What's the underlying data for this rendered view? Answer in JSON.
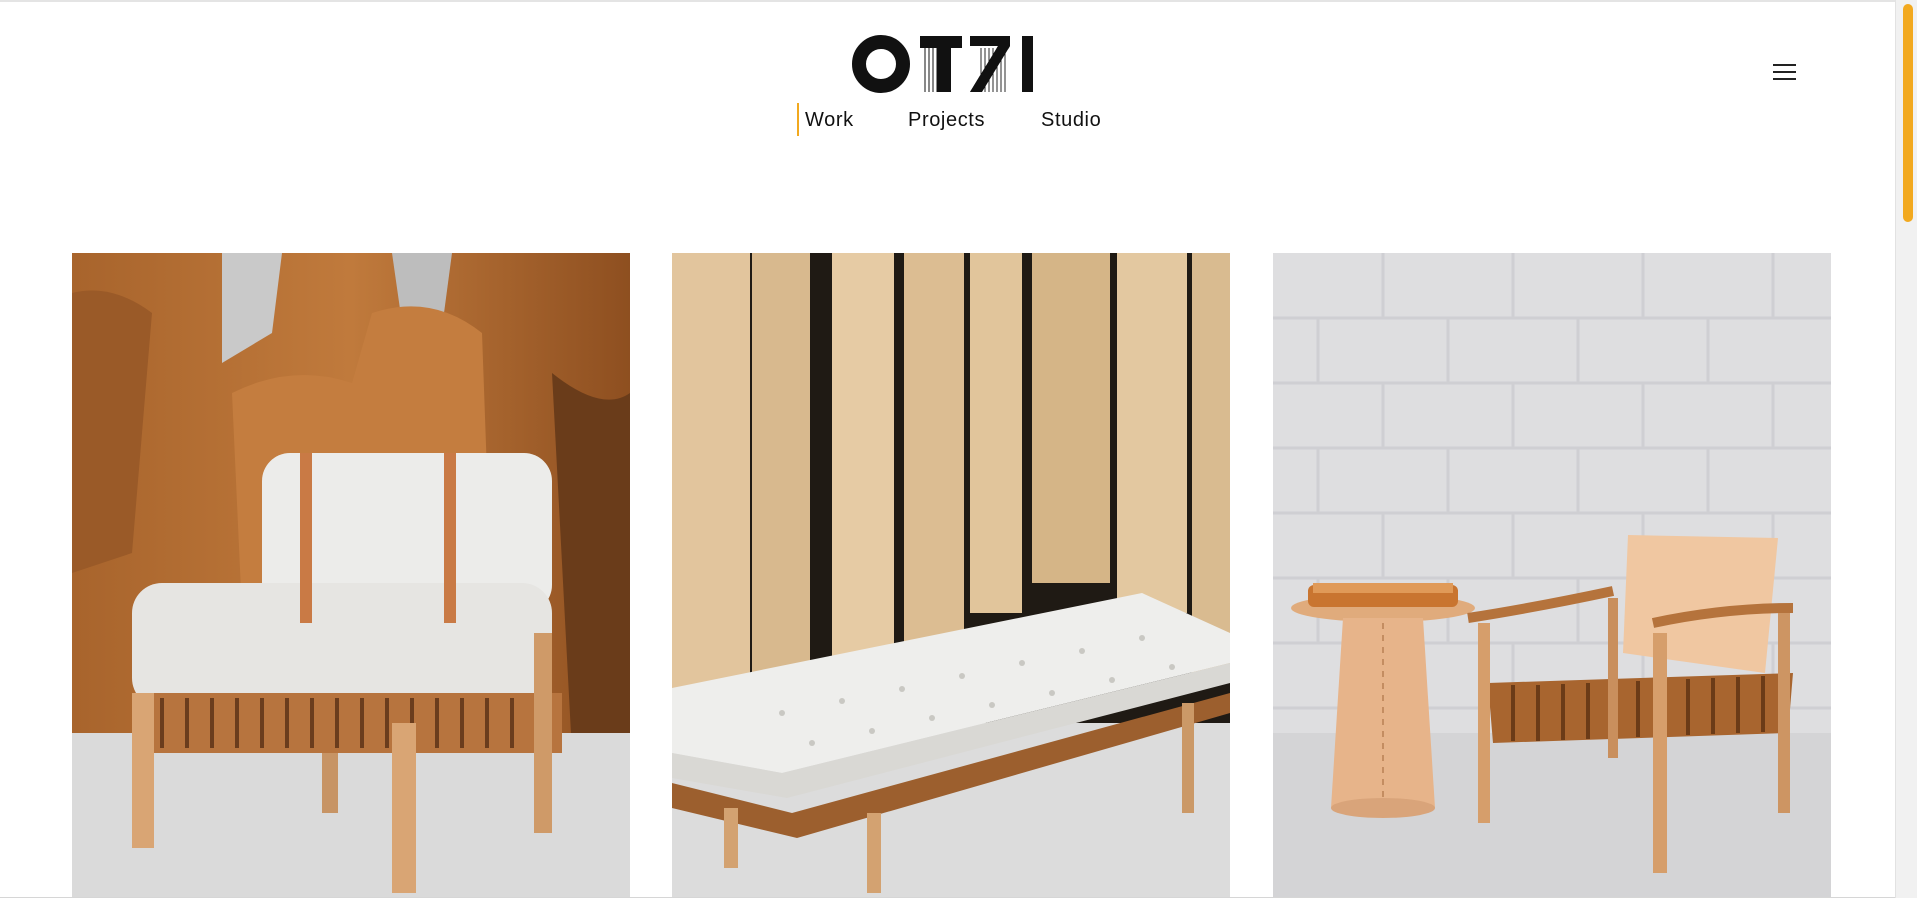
{
  "header": {
    "logo_text": "OTZI",
    "nav": [
      {
        "label": "Work",
        "active": true
      },
      {
        "label": "Projects",
        "active": false
      },
      {
        "label": "Studio",
        "active": false
      }
    ],
    "menu_icon": "hamburger-menu-icon"
  },
  "gallery": [
    {
      "subject": "lounge chair with upholstered cushions, leather straps and woven seat, in front of live-edge wood slabs"
    },
    {
      "subject": "tufted daybed on oak frame with woven leather base, in front of leaning timber boards"
    },
    {
      "subject": "leather sling armchair and round side table with leather tray, against white brick wall"
    }
  ],
  "colors": {
    "accent": "#f2a91f",
    "text": "#111111",
    "background": "#ffffff"
  }
}
